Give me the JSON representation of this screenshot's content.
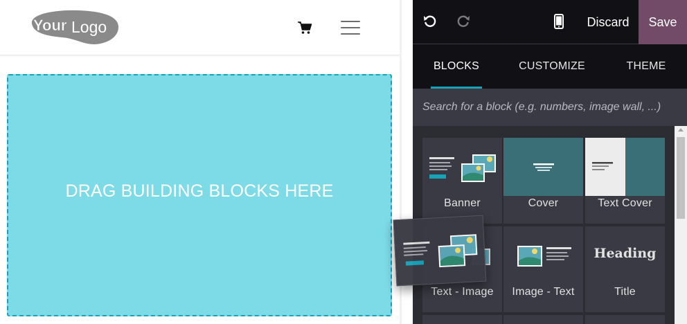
{
  "site": {
    "logo_text_bold": "Your",
    "logo_text_light": "Logo",
    "dropzone_text": "DRAG BUILDING BLOCKS HERE"
  },
  "toolbar": {
    "discard_label": "Discard",
    "save_label": "Save"
  },
  "tabs": [
    {
      "label": "BLOCKS",
      "active": true
    },
    {
      "label": "CUSTOMIZE",
      "active": false
    },
    {
      "label": "THEME",
      "active": false
    }
  ],
  "search": {
    "placeholder": "Search for a block (e.g. numbers, image wall, ...)"
  },
  "blocks": [
    {
      "label": "Banner"
    },
    {
      "label": "Cover"
    },
    {
      "label": "Text Cover"
    },
    {
      "label": "Text - Image"
    },
    {
      "label": "Image - Text"
    },
    {
      "label": "Title",
      "preview_text": "Heading"
    }
  ],
  "colors": {
    "accent": "#17a2b8",
    "save": "#714b67",
    "dropzone": "#7ddbe8",
    "cover": "#3b6f78"
  },
  "icons": [
    "cart-icon",
    "menu-icon",
    "undo-icon",
    "redo-icon",
    "mobile-preview-icon",
    "image-icon"
  ]
}
